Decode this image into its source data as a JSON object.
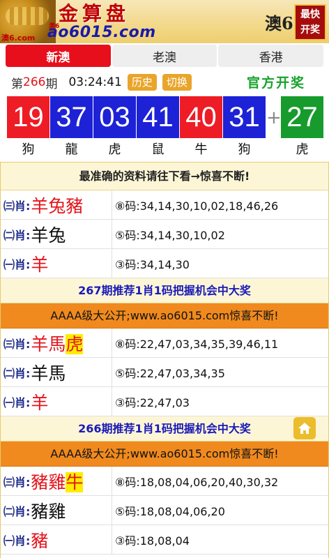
{
  "header": {
    "site_small": "澳6.com",
    "title": "金算盘",
    "macau_small": "澳6",
    "domain": "ao6015.com",
    "macau6": "澳6",
    "fast_open_line1": "最快",
    "fast_open_line2": "开奖"
  },
  "tabs": [
    {
      "label": "新澳",
      "active": true
    },
    {
      "label": "老澳",
      "active": false
    },
    {
      "label": "香港",
      "active": false
    }
  ],
  "draw": {
    "prefix": "第",
    "issue": "266",
    "suffix": "期",
    "time": "03:24:41",
    "history_label": "历史",
    "switch_label": "切换",
    "official_label": "官方开奖"
  },
  "balls": [
    {
      "number": "19",
      "color": "red",
      "zodiac": "狗"
    },
    {
      "number": "37",
      "color": "blue",
      "zodiac": "龍"
    },
    {
      "number": "03",
      "color": "blue",
      "zodiac": "虎"
    },
    {
      "number": "41",
      "color": "blue",
      "zodiac": "鼠"
    },
    {
      "number": "40",
      "color": "red",
      "zodiac": "牛"
    },
    {
      "number": "31",
      "color": "blue",
      "zodiac": "狗"
    },
    {
      "number": "27",
      "color": "green",
      "zodiac": "虎"
    }
  ],
  "plus_sign": "+",
  "colors": {
    "red": "#ee1c25",
    "blue": "#1d22d6",
    "green": "#169b2c",
    "accent": "#e80f1c",
    "gold": "#e9a52b"
  },
  "notice": "最准确的资料请往下看→惊喜不断!",
  "group1": [
    {
      "label": "㈢肖:",
      "zodiac": "羊兔豬",
      "zodiac_color": "red",
      "code": "⑧码:34,14,30,10,02,18,46,26"
    },
    {
      "label": "㈡肖:",
      "zodiac": "羊兔",
      "zodiac_color": "black",
      "code": "⑤码:34,14,30,10,02"
    },
    {
      "label": "㈠肖:",
      "zodiac": "羊",
      "zodiac_color": "red",
      "code": "③码:34,14,30"
    }
  ],
  "banner_267": "267期推荐1肖1码把握机会中大奖",
  "promo_1": "AAAA级大公开;www.ao6015.com惊喜不断!",
  "group2": [
    {
      "label": "㈢肖:",
      "zodiac": "羊馬",
      "zodiac_hl": "虎",
      "zodiac_color": "red",
      "code": "⑧码:22,47,03,34,35,39,46,11"
    },
    {
      "label": "㈡肖:",
      "zodiac": "羊馬",
      "zodiac_color": "black",
      "code": "⑤码:22,47,03,34,35"
    },
    {
      "label": "㈠肖:",
      "zodiac": "羊",
      "zodiac_color": "red",
      "code": "③码:22,47,03"
    }
  ],
  "banner_266": "266期推荐1肖1码把握机会中大奖",
  "promo_2": "AAAA级大公开;www.ao6015.com惊喜不断!",
  "group3": [
    {
      "label": "㈢肖:",
      "zodiac": "豬雞",
      "zodiac_hl": "牛",
      "zodiac_color": "red",
      "code": "⑧码:18,08,04,06,20,40,30,32"
    },
    {
      "label": "㈡肖:",
      "zodiac": "豬雞",
      "zodiac_color": "black",
      "code": "⑤码:18,08,04,06,20"
    },
    {
      "label": "㈠肖:",
      "zodiac": "豬",
      "zodiac_color": "red",
      "code": "③码:18,08,04"
    }
  ],
  "home_icon": "home-icon"
}
